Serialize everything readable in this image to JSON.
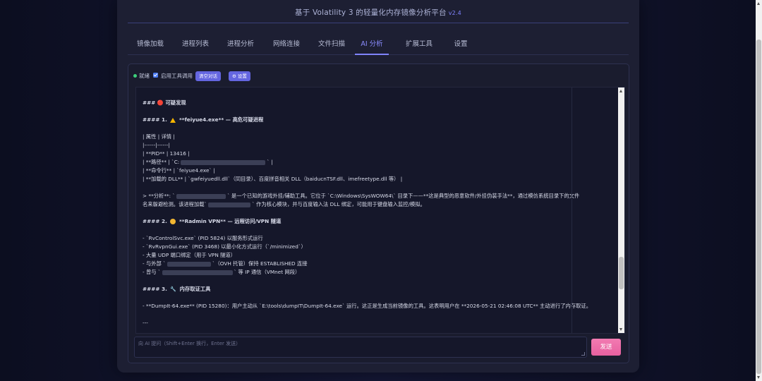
{
  "app": {
    "title": "基于 Volatility 3 的轻量化内存镜像分析平台",
    "version": "v2.4"
  },
  "tabs": [
    {
      "label": "镜像加载",
      "active": false
    },
    {
      "label": "进程列表",
      "active": false
    },
    {
      "label": "进程分析",
      "active": false
    },
    {
      "label": "网络连接",
      "active": false
    },
    {
      "label": "文件扫描",
      "active": false
    },
    {
      "label": "AI 分析",
      "active": true
    },
    {
      "label": "扩展工具",
      "active": false
    },
    {
      "label": "设置",
      "active": false
    }
  ],
  "toolbar": {
    "status": "就绪",
    "status_color": "#3ccf7a",
    "tool_toggle_label": "启用工具调用",
    "tool_toggle_checked": true,
    "clear_button": "清空对话",
    "settings_icon": "gear-icon",
    "settings_button": "⚙ 设置"
  },
  "chat": {
    "h3": "### 🔴 可疑发现",
    "h4_1_prefix": "#### 1.",
    "h4_1_text": "**feiyue4.exe** — 高危可疑进程",
    "t_header": "| 属性 | 详情 |",
    "t_sep": "|------|------|",
    "t_pid": "| **PID** | 13416 |",
    "t_path_prefix": "| **路径** | `C:",
    "t_path_suffix": "` |",
    "t_cmd": "| **命令行** | `feiyue4.exe` |",
    "t_dll": "| **加载的 DLL** | `gwfeiyuedll.dll`（同目录）、百度拼音相关 DLL（baiducnTSF.dll、imefreetype.dll 等） |",
    "analysis_prefix": "> **分析**: `",
    "analysis_mid": "` 是一个已知的游戏外挂/辅助工具。它位于 `C:\\Windows\\SysWOW64\\` 目录下——**这是典型的恶意软件/外挂伪装手法**，通过模仿系统目录下的文件",
    "analysis_line2_prefix": "名来躲避检测。该进程加载`",
    "analysis_line2_suffix": "` 作为核心模块，并与百度输入法 DLL 绑定，可能用于键盘输入监控/模拟。",
    "h4_2_prefix": "#### 2.",
    "h4_2_text": "**Radmin VPN** — 远程访问/VPN 隧道",
    "vpn_1": "- `RvControlSvc.exe` (PID 5824) 以服务形式运行",
    "vpn_2": "- `RvRvpnGui.exe` (PID 3468) 以最小化方式运行（`/minimized`）",
    "vpn_3": "- 大量 UDP 端口绑定（用于 VPN 隧道）",
    "vpn_4_prefix": "- 与外部 `",
    "vpn_4_suffix": "`（OVH 托管）保持 ESTABLISHED 连接",
    "vpn_5_prefix": "- 曾与 `",
    "vpn_5_suffix": "` 等 IP 通信（VMnet 网段）",
    "h4_3_prefix": "#### 3.",
    "wrench_icon": "🔧",
    "h4_3_text": "内存取证工具",
    "dump_line": "- **DumpIt-64.exe** (PID 15280)：用户主动从 `E:\\tools\\dumpIT\\DumpIt-64.exe` 运行。这正是生成当前镜像的工具。这表明用户在 **2026-05-21 02:46:08 UTC** 主动进行了内存取证。",
    "hr": "---"
  },
  "input": {
    "placeholder": "向 AI 提问（Shift+Enter 换行，Enter 发送）",
    "value": ""
  },
  "send_button": "发送",
  "colors": {
    "accent": "#7f83ff",
    "send": "#ec6aa8",
    "status_ok": "#3ccf7a"
  }
}
